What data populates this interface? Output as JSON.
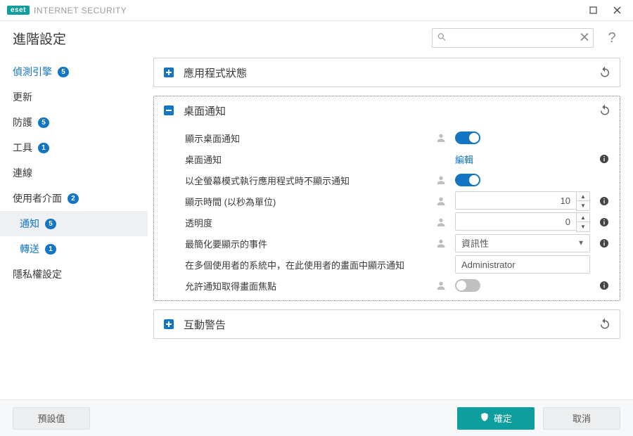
{
  "brand": {
    "badge": "eset",
    "name": "INTERNET SECURITY"
  },
  "page_title": "進階設定",
  "search": {
    "value": "",
    "placeholder": ""
  },
  "help": "?",
  "sidebar": {
    "items": [
      {
        "label": "偵測引擎",
        "badge": "5"
      },
      {
        "label": "更新"
      },
      {
        "label": "防護",
        "badge": "5"
      },
      {
        "label": "工具",
        "badge": "1"
      },
      {
        "label": "連線"
      },
      {
        "label": "使用者介面",
        "badge": "2"
      },
      {
        "label": "通知",
        "badge": "5"
      },
      {
        "label": "轉送",
        "badge": "1"
      },
      {
        "label": "隱私權設定"
      }
    ]
  },
  "sections": {
    "app_status": {
      "title": "應用程式狀態"
    },
    "desktop_notify": {
      "title": "桌面通知",
      "rows": {
        "show": {
          "label": "顯示桌面通知",
          "on": true
        },
        "notify": {
          "label": "桌面通知",
          "link": "編輯"
        },
        "fullscreen": {
          "label": "以全螢幕模式執行應用程式時不顯示通知",
          "on": true
        },
        "duration": {
          "label": "顯示時間 (以秒為單位)",
          "value": "10"
        },
        "opacity": {
          "label": "透明度",
          "value": "0"
        },
        "min_event": {
          "label": "最簡化要顯示的事件",
          "selected": "資訊性"
        },
        "multiuser": {
          "label": "在多個使用者的系統中，在此使用者的畫面中顯示通知",
          "value": "Administrator"
        },
        "focus": {
          "label": "允許通知取得畫面焦點",
          "on": false
        }
      }
    },
    "interactive": {
      "title": "互動警告"
    }
  },
  "footer": {
    "defaults": "預設值",
    "ok": "確定",
    "cancel": "取消"
  }
}
